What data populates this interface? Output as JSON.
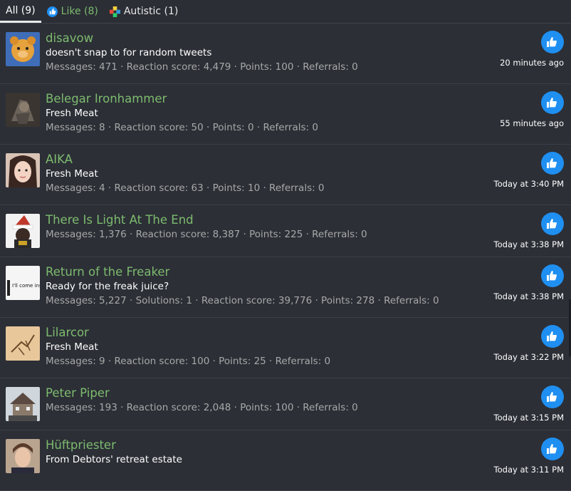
{
  "tabs": [
    {
      "label": "All (9)",
      "icon": null
    },
    {
      "label": "Like (8)",
      "icon": "like-icon"
    },
    {
      "label": "Autistic (1)",
      "icon": "autistic-icon"
    }
  ],
  "rows": [
    {
      "name": "disavow",
      "title": "doesn't snap to for random tweets",
      "stats": "Messages: 471 · Reaction score: 4,479 · Points: 100 · Referrals: 0",
      "time": "20 minutes ago",
      "avatar": "pooh-avatar"
    },
    {
      "name": "Belegar Ironhammer",
      "title": "Fresh Meat",
      "stats": "Messages: 8 · Reaction score: 50 · Points: 0 · Referrals: 0",
      "time": "55 minutes ago",
      "avatar": "dwarf-avatar"
    },
    {
      "name": "AIKA",
      "title": "Fresh Meat",
      "stats": "Messages: 4 · Reaction score: 63 · Points: 10 · Referrals: 0",
      "time": "Today at 3:40 PM",
      "avatar": "woman-avatar"
    },
    {
      "name": "There Is Light At The End",
      "title": "",
      "stats": "Messages: 1,376 · Reaction score: 8,387 · Points: 225 · Referrals: 0",
      "time": "Today at 3:38 PM",
      "avatar": "santa-hat-avatar"
    },
    {
      "name": "Return of the Freaker",
      "title": "Ready for the freak juice?",
      "stats": "Messages: 5,227 · Solutions: 1 · Reaction score: 39,776 · Points: 278 · Referrals: 0",
      "time": "Today at 3:38 PM",
      "avatar": "come-inside-avatar",
      "avatar_text": "I'll come inside"
    },
    {
      "name": "Lilarcor",
      "title": "Fresh Meat",
      "stats": "Messages: 9 · Reaction score: 100 · Points: 25 · Referrals: 0",
      "time": "Today at 3:22 PM",
      "avatar": "sketch-avatar"
    },
    {
      "name": "Peter Piper",
      "title": "",
      "stats": "Messages: 193 · Reaction score: 2,048 · Points: 100 · Referrals: 0",
      "time": "Today at 3:15 PM",
      "avatar": "house-avatar"
    },
    {
      "name": "Hüftpriester",
      "title": "From Debtors' retreat estate",
      "stats": "",
      "time": "Today at 3:11 PM",
      "avatar": "man-avatar"
    }
  ],
  "colors": {
    "background": "#2c2f36",
    "username": "#7dbb6e",
    "like_button": "#1f8ff1",
    "stats": "#a8a8a8"
  }
}
